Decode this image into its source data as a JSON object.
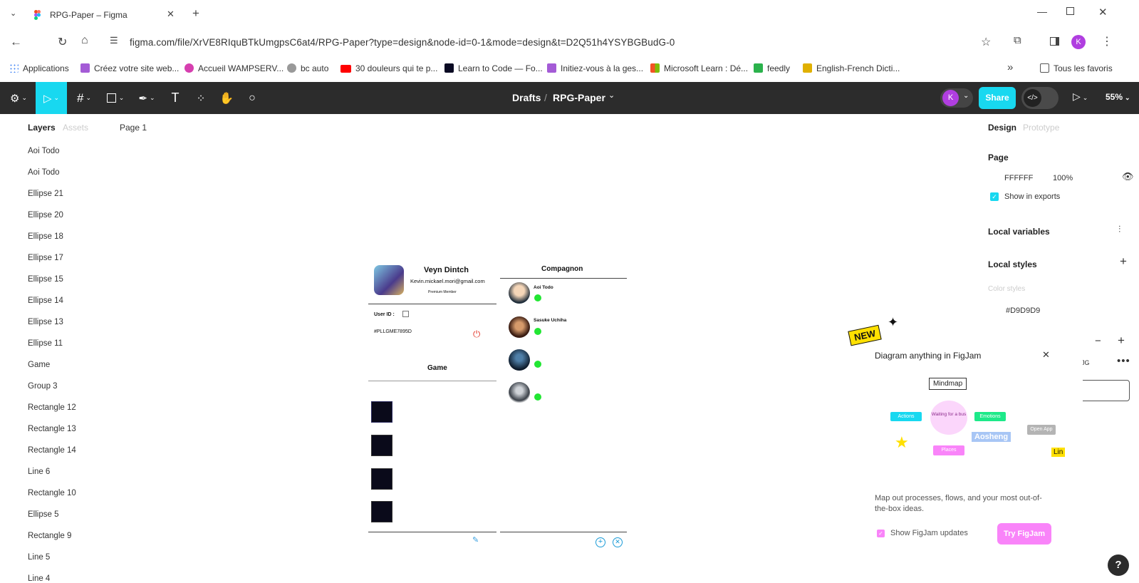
{
  "browser": {
    "tab_title": "RPG-Paper – Figma",
    "url": "figma.com/file/XrVE8RIquBTkUmgpsC6at4/RPG-Paper?type=design&node-id=0-1&mode=design&t=D2Q51h4YSYBGBudG-0",
    "profile_initial": "K",
    "bookmarks": [
      {
        "label": "Applications",
        "color": "#4caf50"
      },
      {
        "label": "Créez votre site web...",
        "color": "#a45bd6"
      },
      {
        "label": "Accueil WAMPSERV...",
        "color": "#d63faf"
      },
      {
        "label": "bc auto",
        "color": "#888888"
      },
      {
        "label": "30 douleurs qui te p...",
        "color": "#ff0000"
      },
      {
        "label": "Learn to Code — Fo...",
        "color": "#0a0a23"
      },
      {
        "label": "Initiez-vous à la ges...",
        "color": "#a45bd6"
      },
      {
        "label": "Microsoft Learn : Dé...",
        "color": "#f35325"
      },
      {
        "label": "feedly",
        "color": "#2bb24c"
      },
      {
        "label": "English-French Dicti...",
        "color": "#e0b000"
      }
    ],
    "all_bookmarks": "Tous les favoris"
  },
  "toolbar": {
    "breadcrumb_root": "Drafts",
    "separator": "/",
    "file_name": "RPG-Paper",
    "avatar_initial": "K",
    "share_label": "Share",
    "zoom": "55%",
    "accent": "#18d8f0"
  },
  "left_panel": {
    "tab_layers": "Layers",
    "tab_assets": "Assets",
    "page_label": "Page 1",
    "layers": [
      "Aoi Todo",
      "Aoi Todo",
      "Ellipse 21",
      "Ellipse 20",
      "Ellipse 18",
      "Ellipse 17",
      "Ellipse 15",
      "Ellipse 14",
      "Ellipse 13",
      "Ellipse 11",
      "Game",
      "Group 3",
      "Rectangle 12",
      "Rectangle 13",
      "Rectangle 14",
      "Line 6",
      "Rectangle 10",
      "Ellipse 5",
      "Rectangle 9",
      "Line 5",
      "Line 4"
    ]
  },
  "right_panel": {
    "tab_design": "Design",
    "tab_prototype": "Prototype",
    "page_section": "Page",
    "page_color": "FFFFFF",
    "page_opacity": "100%",
    "show_in_exports": "Show in exports",
    "local_variables": "Local variables",
    "local_styles": "Local styles",
    "color_styles": "Color styles",
    "color_style_value": "#D9D9D9",
    "partial_text": "JG"
  },
  "profile_card": {
    "name": "Veyn Dintch",
    "email": "Kevin.mickael.mori@gmail.com",
    "membership": "Premium Member",
    "user_id_label": "User ID :",
    "user_id_value": "#PLLGME7895D",
    "game_title": "Game"
  },
  "companion_card": {
    "title": "Compagnon",
    "companions": [
      {
        "name": "Aoi Todo"
      },
      {
        "name": "Sasuke Uchiha"
      },
      {
        "name": ""
      },
      {
        "name": ""
      }
    ]
  },
  "figjam_popup": {
    "badge": "NEW",
    "title": "Diagram anything in FigJam",
    "mindmap": "Mindmap",
    "center_node": "Waiting for a bus",
    "node_actions": "Actions",
    "node_emotions": "Emotions",
    "node_places": "Places",
    "cursor_name": "Aosheng",
    "open_app": "Open App",
    "partial_label": "Lin",
    "description": "Map out processes, flows, and your most out-of-the-box ideas.",
    "checkbox_label": "Show FigJam updates",
    "cta": "Try FigJam",
    "cta_color": "#f984f9"
  },
  "help_label": "?"
}
